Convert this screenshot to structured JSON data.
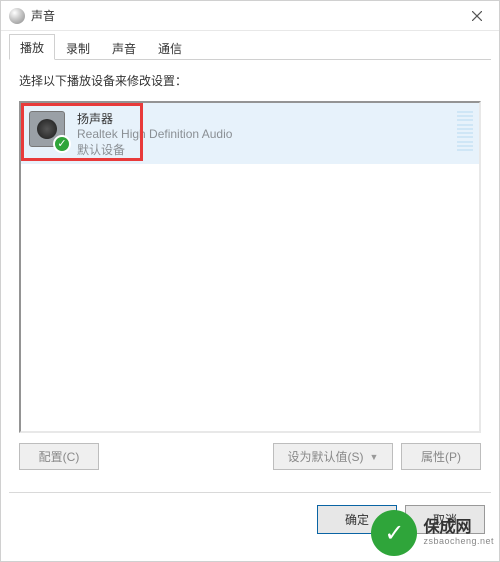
{
  "window": {
    "title": "声音"
  },
  "tabs": [
    {
      "label": "播放",
      "active": true
    },
    {
      "label": "录制",
      "active": false
    },
    {
      "label": "声音",
      "active": false
    },
    {
      "label": "通信",
      "active": false
    }
  ],
  "instruction": "选择以下播放设备来修改设置：",
  "device": {
    "name": "扬声器",
    "driver": "Realtek High Definition Audio",
    "status": "默认设备",
    "selected": true,
    "highlighted": true
  },
  "buttons": {
    "configure": "配置(C)",
    "set_default": "设为默认值(S)",
    "properties": "属性(P)",
    "ok": "确定",
    "cancel": "取消"
  },
  "watermark": {
    "brand": "保成网",
    "domain": "zsbaocheng.net"
  }
}
